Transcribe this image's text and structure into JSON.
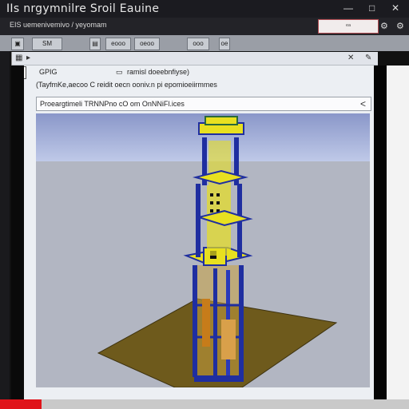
{
  "window": {
    "title": "IIs nrgymnilre Sroil Eauine",
    "controls": [
      "—",
      "□",
      "✕"
    ]
  },
  "menubar": {
    "path": "EIS uemenivemivo / yeyomam",
    "field_value": "ᵉᵃ",
    "icons": [
      "✕",
      "⚙",
      "⚙"
    ]
  },
  "toolbar": {
    "buttons": [
      "▣",
      "SM",
      "▤",
      "eooo",
      "oeoo",
      "ooo",
      "oe"
    ]
  },
  "panel": {
    "crumb_left": "GPIG",
    "crumb_mid": "ramisl doeebnfiyse)",
    "description": "(TayfmKe,aecoo  C reidit oecn ooniv.n  pi  epomioeiirmmes",
    "address": "Proeargtimeli TRNNPno cO om OnNNiFl.ices",
    "back_glyph": "<",
    "crumb_icons": [
      "✕",
      "⚙"
    ]
  },
  "scene": {
    "sky_top": "#8a97c9",
    "sky_bottom": "#bfc9e8",
    "floor": "#b2b6c2",
    "plate": "#6e5a1c",
    "frame_blue": "#1f2ea0",
    "accent_yellow": "#e8e020"
  }
}
